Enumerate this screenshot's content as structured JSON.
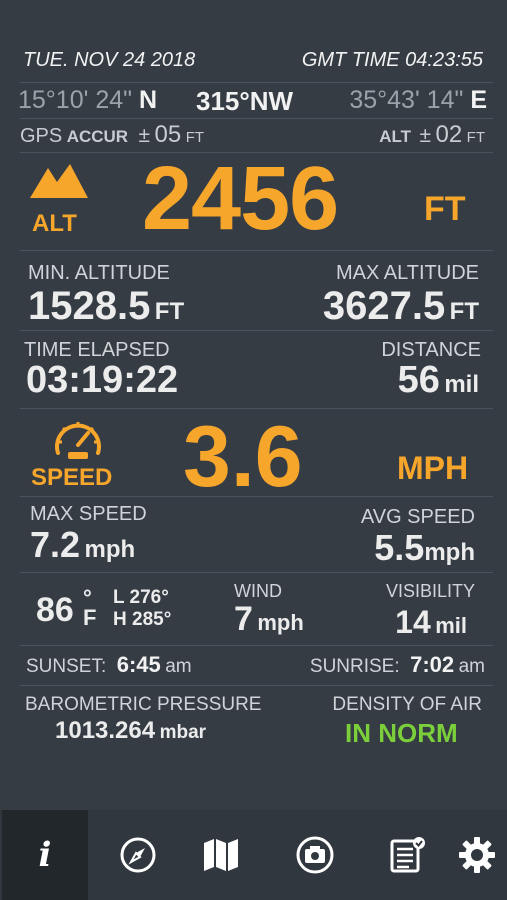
{
  "header": {
    "date": "TUE.  NOV 24 2018",
    "gmt_time": "GMT TIME 04:23:55"
  },
  "coords": {
    "lat_value": "15°10' 24\"",
    "lat_dir": "N",
    "heading": "315°NW",
    "lon_value": "35°43' 14\"",
    "lon_dir": "E"
  },
  "gps": {
    "label": "GPS",
    "accur_label": "ACCUR",
    "accur_pm": "±",
    "accur_value": "05",
    "accur_unit": "FT",
    "alt_label": "ALT",
    "alt_pm": "±",
    "alt_value": "02",
    "alt_unit": "FT"
  },
  "altitude": {
    "label": "ALT",
    "value": "2456",
    "unit": "FT"
  },
  "min_altitude": {
    "label": "MIN. ALTITUDE",
    "value": "1528.5",
    "unit": "FT"
  },
  "max_altitude": {
    "label": "MAX ALTITUDE",
    "value": "3627.5",
    "unit": "FT"
  },
  "time_elapsed": {
    "label": "TIME ELAPSED",
    "value": "03:19:22"
  },
  "distance": {
    "label": "DISTANCE",
    "value": "56",
    "unit": "mil"
  },
  "speed": {
    "label": "SPEED",
    "value": "3.6",
    "unit": "MPH"
  },
  "max_speed": {
    "label": "MAX SPEED",
    "value": "7.2",
    "unit": "mph"
  },
  "avg_speed": {
    "label": "AVG SPEED",
    "value": "5.5",
    "unit": "mph"
  },
  "temperature": {
    "value": "86",
    "deg": "°",
    "unit": "F",
    "low": "L 276°",
    "high": "H 285°"
  },
  "wind": {
    "label": "WIND",
    "value": "7",
    "unit": "mph"
  },
  "visibility": {
    "label": "VISIBILITY",
    "value": "14",
    "unit": "mil"
  },
  "sun": {
    "sunset_label": "SUNSET:",
    "sunset_value": "6:45",
    "sunset_unit": "am",
    "sunrise_label": "SUNRISE:",
    "sunrise_value": "7:02",
    "sunrise_unit": "am"
  },
  "pressure": {
    "label": "BAROMETRIC PRESSURE",
    "value": "1013.264",
    "unit": "mbar"
  },
  "air_density": {
    "label": "DENSITY OF AIR",
    "value": "IN NORM"
  },
  "nav": {
    "info": "info-icon",
    "compass": "compass-icon",
    "map": "map-icon",
    "camera": "camera-icon",
    "notes": "notes-icon",
    "settings": "gear-icon"
  },
  "colors": {
    "background": "#353c44",
    "accent": "#f7a62c",
    "ok": "#7bcf3a",
    "divider": "#4b545d",
    "nav_background": "#31373e",
    "nav_active": "#22272c"
  }
}
